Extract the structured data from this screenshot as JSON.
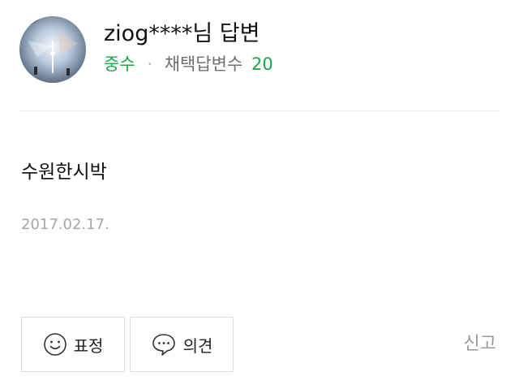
{
  "author": {
    "name": "ziog****님 답변",
    "rank": "중수",
    "separator": "·",
    "adopted_label": "채택답변수",
    "adopted_count": "20"
  },
  "answer": {
    "text": "수원한시박",
    "date": "2017.02.17."
  },
  "actions": {
    "emotion_label": "표정",
    "opinion_label": "의견",
    "report_label": "신고"
  },
  "colors": {
    "accent_green": "#1fa447",
    "muted_gray": "#a6a6a6"
  },
  "icons": {
    "avatar": "profile-photo",
    "emotion": "smiley-face-icon",
    "opinion": "speech-bubble-icon"
  }
}
